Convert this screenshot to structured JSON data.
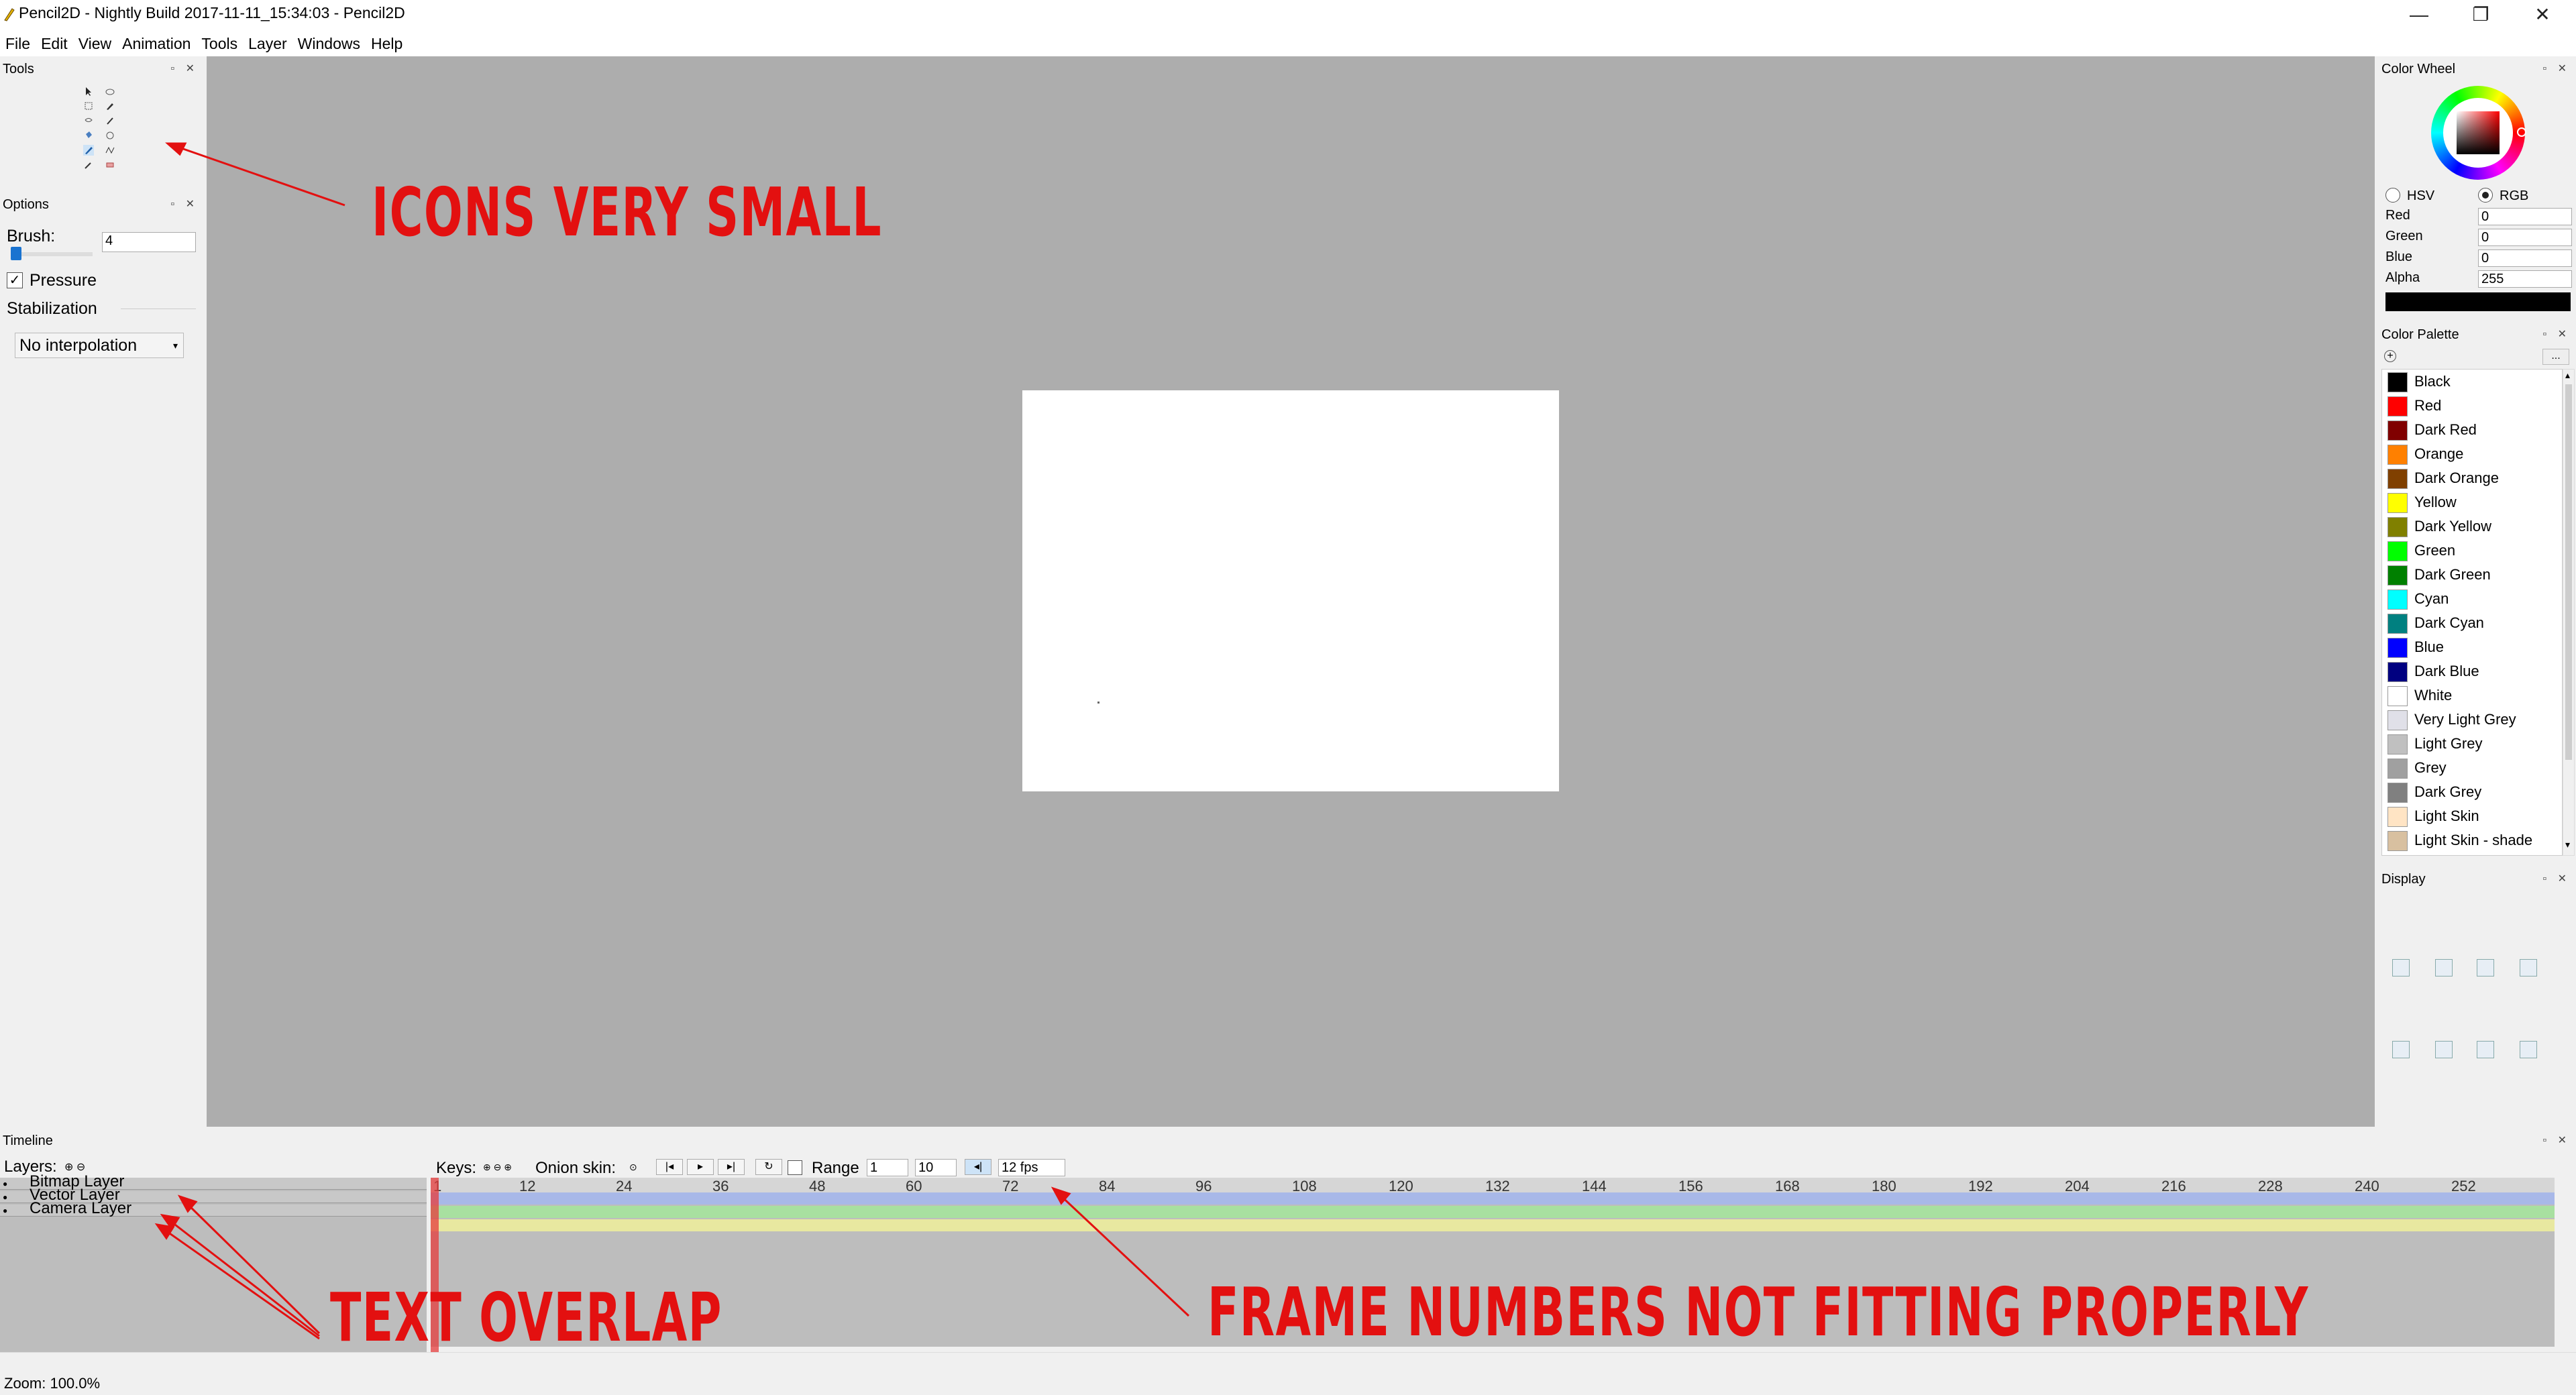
{
  "window": {
    "title": "Pencil2D - Nightly Build 2017-11-11_15:34:03 - Pencil2D",
    "minimize": "—",
    "maximize": "❐",
    "close": "✕"
  },
  "menu": [
    "File",
    "Edit",
    "View",
    "Animation",
    "Tools",
    "Layer",
    "Windows",
    "Help"
  ],
  "tools_panel": {
    "title": "Tools"
  },
  "options_panel": {
    "title": "Options",
    "brush_label": "Brush:",
    "brush_value": "4",
    "brush_fraction": 0.05,
    "pressure_label": "Pressure",
    "pressure_checked": true,
    "stabilization_label": "Stabilization",
    "interpolation_value": "No interpolation"
  },
  "color_wheel": {
    "title": "Color Wheel",
    "hsv_label": "HSV",
    "rgb_label": "RGB",
    "mode": "RGB",
    "fields": [
      {
        "label": "Red",
        "value": "0"
      },
      {
        "label": "Green",
        "value": "0"
      },
      {
        "label": "Blue",
        "value": "0"
      },
      {
        "label": "Alpha",
        "value": "255"
      }
    ],
    "current_color": "#000000"
  },
  "color_palette": {
    "title": "Color Palette",
    "menu_button": "...",
    "items": [
      {
        "name": "Black",
        "color": "#000000"
      },
      {
        "name": "Red",
        "color": "#ff0000"
      },
      {
        "name": "Dark Red",
        "color": "#800000"
      },
      {
        "name": "Orange",
        "color": "#ff8000"
      },
      {
        "name": "Dark Orange",
        "color": "#804000"
      },
      {
        "name": "Yellow",
        "color": "#ffff00"
      },
      {
        "name": "Dark Yellow",
        "color": "#808000"
      },
      {
        "name": "Green",
        "color": "#00ff00"
      },
      {
        "name": "Dark Green",
        "color": "#008000"
      },
      {
        "name": "Cyan",
        "color": "#00ffff"
      },
      {
        "name": "Dark Cyan",
        "color": "#008080"
      },
      {
        "name": "Blue",
        "color": "#0000ff"
      },
      {
        "name": "Dark Blue",
        "color": "#000080"
      },
      {
        "name": "White",
        "color": "#ffffff"
      },
      {
        "name": "Very Light Grey",
        "color": "#e0e0e8"
      },
      {
        "name": "Light Grey",
        "color": "#c0c0c0"
      },
      {
        "name": "Grey",
        "color": "#a0a0a0"
      },
      {
        "name": "Dark Grey",
        "color": "#808080"
      },
      {
        "name": "Light Skin",
        "color": "#ffe4c4"
      },
      {
        "name": "Light Skin - shade",
        "color": "#d8c0a0"
      }
    ]
  },
  "display_panel": {
    "title": "Display"
  },
  "timeline": {
    "title": "Timeline",
    "layers_label": "Layers:",
    "keys_label": "Keys:",
    "onion_label": "Onion skin:",
    "range_label": "Range",
    "range_start": "1",
    "range_end": "10",
    "fps": "12 fps",
    "frame_numbers": [
      "1",
      "12",
      "24",
      "36",
      "48",
      "60",
      "72",
      "84",
      "96",
      "108",
      "120",
      "132",
      "144",
      "156",
      "168",
      "180",
      "192",
      "204",
      "216",
      "228",
      "240",
      "252"
    ],
    "layers": [
      {
        "name": "Bitmap Layer",
        "color": "#a8b8e8"
      },
      {
        "name": "Vector Layer",
        "color": "#a8e0a0"
      },
      {
        "name": "Camera Layer",
        "color": "#e8e8a0"
      }
    ]
  },
  "status": {
    "zoom": "Zoom: 100.0%"
  },
  "annotations": {
    "icons": "ICONS VERY SMALL",
    "text_overlap": "TEXT OVERLAP",
    "frame_numbers": "FRAME NUMBERS NOT FITTING PROPERLY"
  }
}
